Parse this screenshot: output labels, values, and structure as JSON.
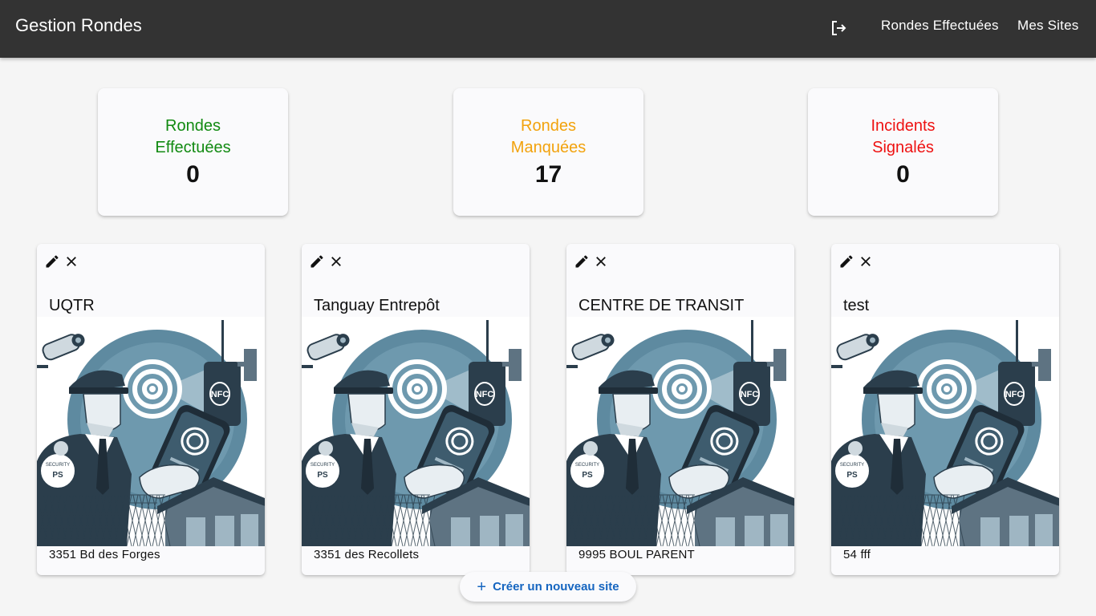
{
  "header": {
    "title": "Gestion Rondes",
    "logout_icon": "logout-icon",
    "nav": [
      "Rondes Effectuées",
      "Mes Sites"
    ]
  },
  "stats": [
    {
      "label": "Rondes Effectuées",
      "value": "0",
      "color": "#118a11"
    },
    {
      "label": "Rondes Manquées",
      "value": "17",
      "color": "#f2a20c"
    },
    {
      "label": "Incidents Signalés",
      "value": "0",
      "color": "#ee1111"
    }
  ],
  "sites": [
    {
      "name": "UQTR",
      "address": "3351 Bd des Forges",
      "image": "security-guard-nfc-illustration"
    },
    {
      "name": "Tanguay Entrepôt",
      "address": "3351 des Recollets",
      "image": "security-guard-nfc-illustration"
    },
    {
      "name": "CENTRE DE TRANSIT",
      "address": "9995 BOUL PARENT",
      "image": "security-guard-nfc-illustration"
    },
    {
      "name": "test",
      "address": "54 fff",
      "image": "security-guard-nfc-illustration"
    }
  ],
  "card_icons": {
    "edit": "pencil-icon",
    "delete": "close-icon"
  },
  "create_button": {
    "label": "Créer un nouveau site",
    "icon": "plus-icon",
    "color": "#1565c0"
  },
  "nfc_label": "NFC",
  "badge_text": {
    "line1": "SECURITY",
    "line2": "PS"
  }
}
